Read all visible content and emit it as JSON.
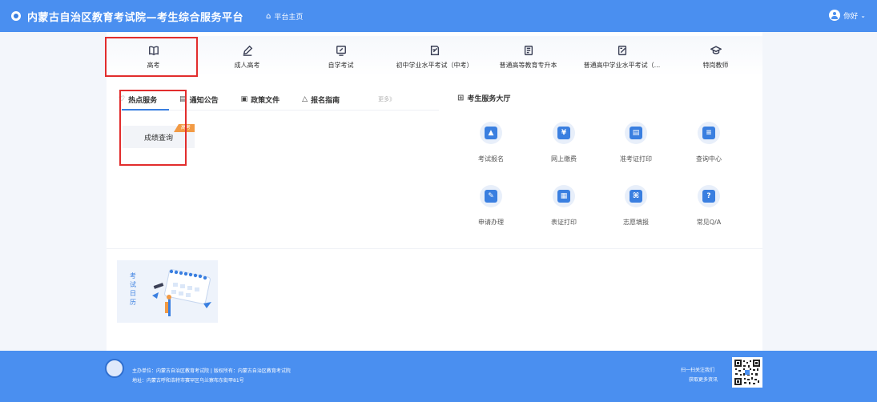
{
  "header": {
    "title": "内蒙古自治区教育考试院—考生综合服务平台",
    "home_link": "平台主页",
    "user_greeting": "你好"
  },
  "categories": [
    {
      "label": "高考",
      "icon": "book-open-icon"
    },
    {
      "label": "成人高考",
      "icon": "pen-icon"
    },
    {
      "label": "自学考试",
      "icon": "edit-board-icon"
    },
    {
      "label": "初中学业水平考试（中考）",
      "icon": "exam-edit-icon"
    },
    {
      "label": "普通高等教育专升本",
      "icon": "document-icon"
    },
    {
      "label": "普通高中学业水平考试（...",
      "icon": "note-edit-icon"
    },
    {
      "label": "特岗教师",
      "icon": "graduation-cap-icon"
    }
  ],
  "service_tabs": {
    "hot": "热点服务",
    "notice": "通知公告",
    "policy": "政策文件",
    "guide": "报名指南",
    "more": "更多》"
  },
  "hall_title": "考生服务大厅",
  "score_card": {
    "label": "成绩查询",
    "tag": "高考"
  },
  "services": [
    {
      "label": "考试报名",
      "icon": "graduation-cap-icon"
    },
    {
      "label": "网上缴费",
      "icon": "payment-icon"
    },
    {
      "label": "准考证打印",
      "icon": "printer-icon"
    },
    {
      "label": "查询中心",
      "icon": "document-search-icon"
    },
    {
      "label": "申请办理",
      "icon": "application-icon"
    },
    {
      "label": "表证打印",
      "icon": "form-print-icon"
    },
    {
      "label": "志愿填报",
      "icon": "grid-clover-icon"
    },
    {
      "label": "常见Q/A",
      "icon": "qa-icon"
    }
  ],
  "calendar": {
    "label_chars": [
      "考",
      "试",
      "日",
      "历"
    ]
  },
  "footer": {
    "line1": "主办单位：内蒙古自治区教育考试院 | 版权所有：内蒙古自治区教育考试院",
    "line2": "地址：内蒙古呼和浩特市赛罕区乌兰察布东街甲81号",
    "follow1": "扫一扫关注我们",
    "follow2": "获取更多资讯"
  },
  "colors": {
    "primary": "#4a8ff0",
    "highlight_border": "#e22d2d",
    "tag_orange": "#f29a44"
  }
}
